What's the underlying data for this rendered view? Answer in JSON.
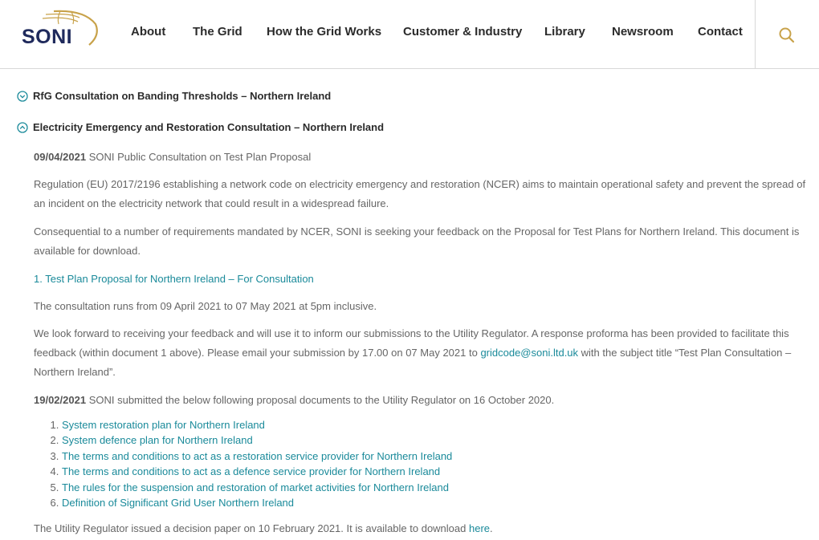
{
  "nav": {
    "logo": "SONI",
    "items": [
      "About",
      "The Grid",
      "How the Grid Works",
      "Customer & Industry",
      "Library",
      "Newsroom",
      "Contact"
    ]
  },
  "accordion": {
    "item_rfg": "RfG Consultation on Banding Thresholds – Northern Ireland",
    "item_ncer": "Electricity Emergency and Restoration Consultation – Northern Ireland"
  },
  "content": {
    "u1_date": "09/04/2021",
    "u1_title": " SONI Public Consultation on Test Plan Proposal",
    "para1": "Regulation (EU) 2017/2196 establishing a network code on electricity emergency and restoration (NCER) aims to maintain operational safety and prevent the spread of an incident on the electricity network that could result in a widespread failure.",
    "para2": "Consequential to a number of requirements mandated by NCER, SONI is seeking your feedback on the Proposal for Test Plans for Northern Ireland. This document is available for download.",
    "doc_prefix": "1. ",
    "doc_link": "Test Plan Proposal for Northern Ireland – For Consultation",
    "para3": "The consultation runs from 09 April 2021 to 07 May 2021 at 5pm inclusive.",
    "para4a": "We look forward to receiving your feedback and will use it to inform our submissions to the Utility Regulator. A response proforma has been provided to facilitate this feedback (within document 1 above). Please email your submission by 17.00 on 07 May 2021 to ",
    "email": "gridcode@soni.ltd.uk",
    "para4b": " with the subject title “Test Plan Consultation – Northern Ireland”.",
    "u2_date": "19/02/2021",
    "u2_text": " SONI submitted the below following proposal documents to the Utility Regulator on 16 October 2020.",
    "docs": [
      "System restoration plan for Northern Ireland",
      "System defence plan for Northern Ireland",
      "The terms and conditions to act as a restoration service provider for Northern Ireland",
      "The terms and conditions to act as a defence service provider for Northern Ireland",
      "The rules for the suspension and restoration of market activities for Northern Ireland",
      "Definition of Significant Grid User Northern Ireland"
    ],
    "final_a": "The Utility Regulator issued a decision paper on 10 February 2021. It is available to download ",
    "final_link": "here",
    "final_b": "."
  },
  "colors": {
    "brand_navy": "#1f2a5c",
    "brand_gold": "#c8a24a",
    "link": "#1a8a9a"
  }
}
